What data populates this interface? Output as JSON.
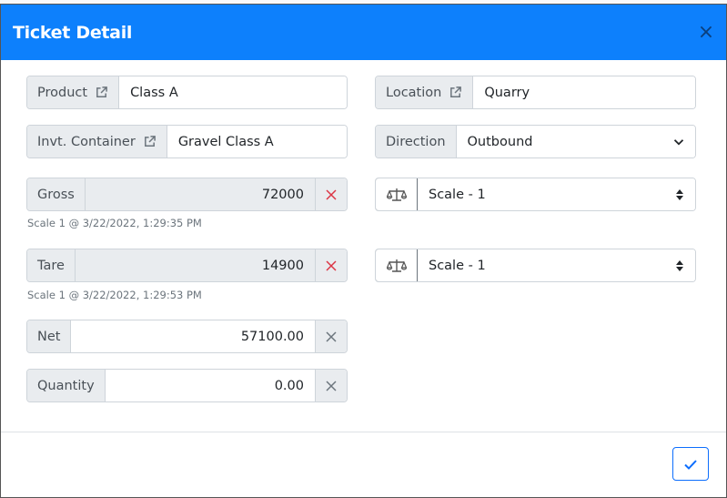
{
  "dialog": {
    "title": "Ticket Detail",
    "close_symbol": "×"
  },
  "fields": {
    "product": {
      "label": "Product",
      "value": "Class A"
    },
    "location": {
      "label": "Location",
      "value": "Quarry"
    },
    "invt_container": {
      "label": "Invt. Container",
      "value": "Gravel Class A"
    },
    "direction": {
      "label": "Direction",
      "value": "Outbound"
    },
    "gross": {
      "label": "Gross",
      "value": "72000",
      "hint": "Scale 1 @ 3/22/2022, 1:29:35 PM"
    },
    "gross_scale": {
      "value": "Scale - 1"
    },
    "tare": {
      "label": "Tare",
      "value": "14900",
      "hint": "Scale 1 @ 3/22/2022, 1:29:53 PM"
    },
    "tare_scale": {
      "value": "Scale - 1"
    },
    "net": {
      "label": "Net",
      "value": "57100.00"
    },
    "quantity": {
      "label": "Quantity",
      "value": "0.00"
    }
  },
  "icons": {
    "external_link": "external-link-icon",
    "clear": "times-icon",
    "scale": "balance-scale-icon",
    "sort": "sort-icon",
    "chevron": "chevron-down-icon",
    "confirm": "check-icon"
  },
  "colors": {
    "header": "#0d80fc",
    "clear_red": "#dc3545",
    "primary": "#0d6efd"
  }
}
